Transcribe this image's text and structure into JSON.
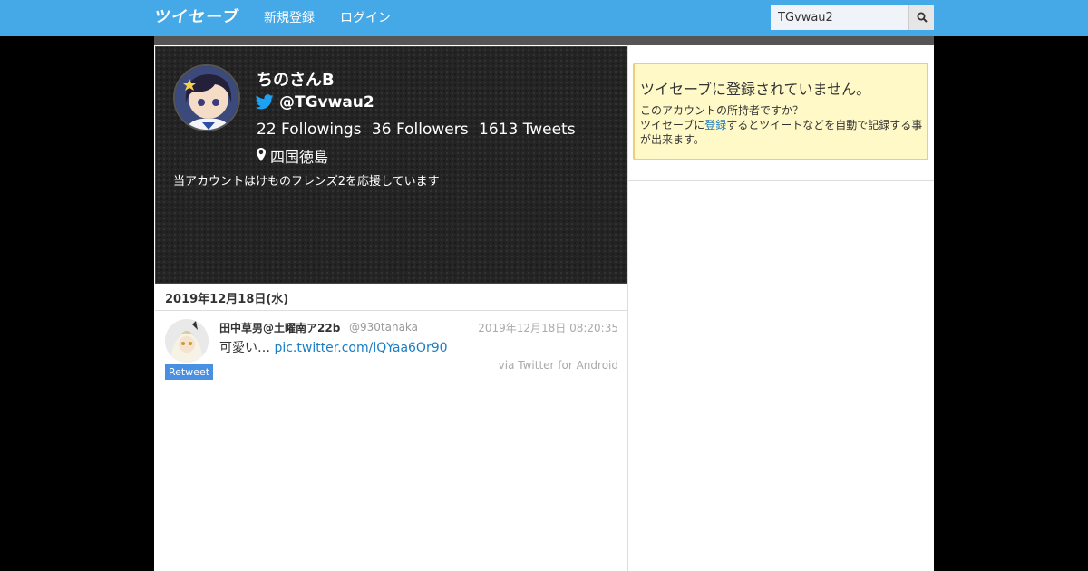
{
  "header": {
    "logo": "ツイセーブ",
    "nav": [
      "新規登録",
      "ログイン"
    ],
    "search_value": "TGvwau2",
    "brand_color": "#45a9e8"
  },
  "profile": {
    "name": "ちのさんB",
    "handle": "@TGvwau2",
    "followings": "22 Followings",
    "followers": "36 Followers",
    "tweets": "1613 Tweets",
    "location": "四国徳島",
    "bio": "当アカウントはけものフレンズ2を応援しています"
  },
  "timeline": {
    "date": "2019年12月18日(水)",
    "tweets": [
      {
        "name": "田中草男@土曜南ア22b",
        "handle": "@930tanaka",
        "time": "2019年12月18日 08:20:35",
        "text": "可愛い… ",
        "link": "pic.twitter.com/lQYaa6Or90",
        "via": "via Twitter for Android",
        "badge": "Retweet"
      }
    ]
  },
  "notice": {
    "title": "ツイセーブに登録されていません。",
    "line1": "このアカウントの所持者ですか？",
    "line2_prefix": "ツイセーブに",
    "line2_link": "登録",
    "line2_suffix": "するとツイートなどを自動で記録する事が出来ます。"
  },
  "icons": [
    "search-icon",
    "twitter-bird-icon",
    "map-marker-icon"
  ]
}
